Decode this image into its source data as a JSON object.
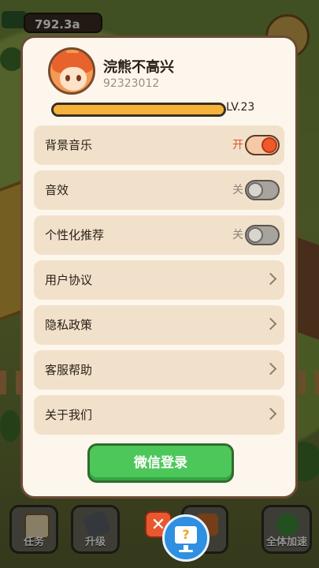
{
  "hud": {
    "money": "792.3a"
  },
  "profile": {
    "name": "浣熊不高兴",
    "id": "92323012",
    "level": "LV.23",
    "progress": 1.0
  },
  "settings": [
    {
      "label": "背景音乐",
      "type": "toggle",
      "state": "开",
      "on": true
    },
    {
      "label": "音效",
      "type": "toggle",
      "state": "关",
      "on": false
    },
    {
      "label": "个性化推荐",
      "type": "toggle",
      "state": "关",
      "on": false
    },
    {
      "label": "用户协议",
      "type": "link"
    },
    {
      "label": "隐私政策",
      "type": "link"
    },
    {
      "label": "客服帮助",
      "type": "link"
    },
    {
      "label": "关于我们",
      "type": "link"
    }
  ],
  "login_button": "微信登录",
  "bottom_bar": {
    "task": "任务",
    "upgrade": "升级",
    "speed_all": "全体加速"
  },
  "colors": {
    "accent_on": "#f05a2a",
    "login_green": "#4ec75a",
    "panel_bg": "#fdf6ec",
    "row_bg": "#f1e1cb"
  }
}
